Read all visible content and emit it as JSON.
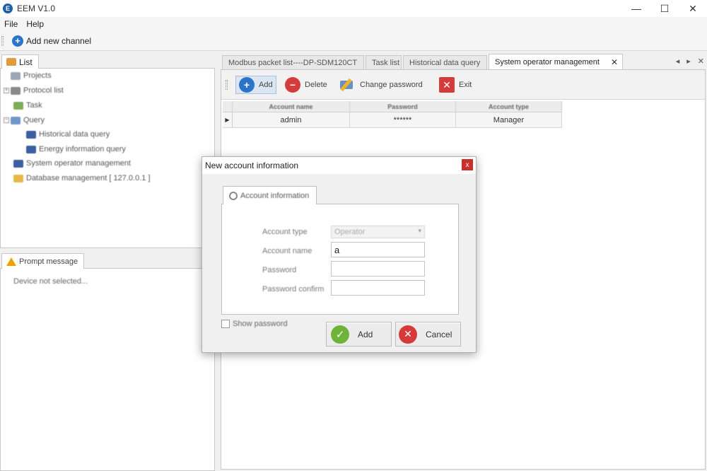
{
  "window": {
    "title": "EEM V1.0",
    "logo_letter": "E",
    "minimize_glyph": "—",
    "maximize_glyph": "☐",
    "close_glyph": "✕"
  },
  "menu": {
    "items": [
      "File",
      "Help"
    ]
  },
  "toolbar": {
    "add_channel_label": "Add new channel",
    "add_channel_icon": "plus-circle-icon"
  },
  "left_panel": {
    "tab_label": "List",
    "tree": [
      {
        "label": "Projects",
        "icon_color": "#9aa7b5"
      },
      {
        "label": "Protocol list",
        "icon_color": "#8a8a8a"
      },
      {
        "label": "Task",
        "icon_color": "#7fae5b"
      },
      {
        "label": "Query",
        "icon_color": "#6f98c9"
      },
      {
        "label": "Historical data query",
        "icon_color": "#3b5fa0"
      },
      {
        "label": "Energy information query",
        "icon_color": "#3b5fa0"
      },
      {
        "label": "System operator management",
        "icon_color": "#3b5fa0"
      },
      {
        "label": "Database management [ 127.0.0.1 ]",
        "icon_color": "#e6b84a"
      }
    ]
  },
  "prompt_panel": {
    "tab_label": "Prompt message",
    "message": "Device not selected..."
  },
  "doc_tabs": {
    "tabs": [
      {
        "label": "Modbus packet list----DP-SDM120CT",
        "active": false
      },
      {
        "label": "Task list",
        "active": false
      },
      {
        "label": "Historical data query",
        "active": false
      },
      {
        "label": "System operator management",
        "active": true
      }
    ],
    "close_glyph": "✕",
    "nav_prev": "◂",
    "nav_next": "▸",
    "nav_close": "✕"
  },
  "doc_toolbar": {
    "add_label": "Add",
    "delete_label": "Delete",
    "change_password_label": "Change password",
    "exit_label": "Exit"
  },
  "accounts_table": {
    "columns": [
      "Account name",
      "Password",
      "Account type"
    ],
    "rows": [
      {
        "marker": "▶",
        "name": "admin",
        "password": "******",
        "type": "Manager"
      }
    ]
  },
  "dialog": {
    "title": "New account information",
    "close_glyph": "x",
    "tab_label": "Account information",
    "fields": {
      "account_type_label": "Account type",
      "account_type_value": "Operator",
      "account_name_label": "Account name",
      "account_name_value": "a",
      "password_label": "Password",
      "password_value": "",
      "password_confirm_label": "Password confirm",
      "password_confirm_value": ""
    },
    "show_password_label": "Show password",
    "add_button_label": "Add",
    "cancel_button_label": "Cancel",
    "ok_glyph": "✓",
    "cancel_glyph": "✕"
  }
}
